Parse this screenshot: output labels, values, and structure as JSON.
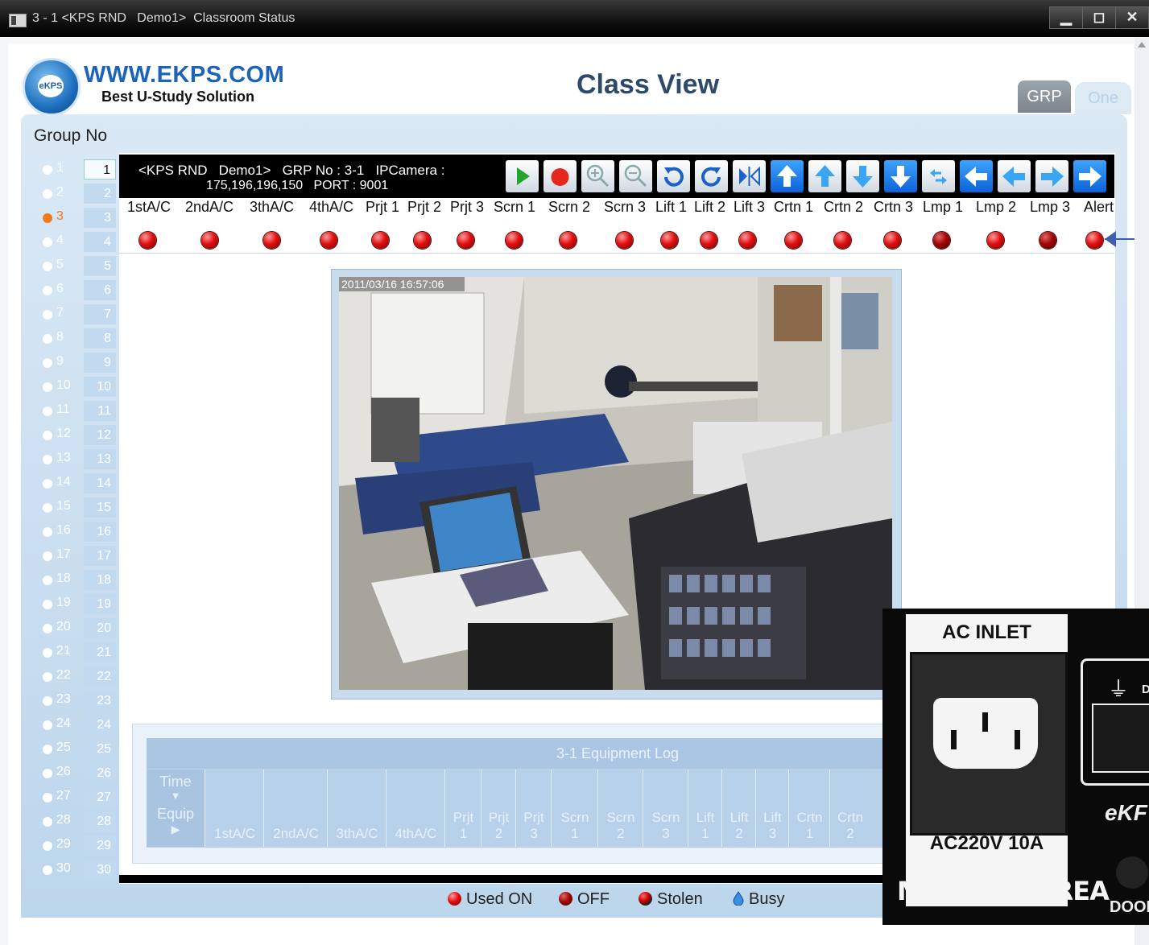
{
  "window": {
    "title": "3 - 1 <KPS RND   Demo1>  Classroom Status",
    "controls": [
      "▁",
      "◻",
      "✕"
    ]
  },
  "header": {
    "logo_badge": "eKPS",
    "logo_url": "WWW.EKPS.COM",
    "logo_tagline": "Best U-Study Solution",
    "page_title": "Class View",
    "tabs": [
      "GRP",
      "One"
    ]
  },
  "group": {
    "label": "Group No",
    "selected": 3,
    "items": [
      "1",
      "2",
      "3",
      "4",
      "5",
      "6",
      "7",
      "8",
      "9",
      "10",
      "11",
      "12",
      "13",
      "14",
      "15",
      "16",
      "17",
      "18",
      "19",
      "20",
      "21",
      "22",
      "23",
      "24",
      "25",
      "26",
      "27",
      "28",
      "29",
      "30"
    ]
  },
  "info": {
    "line1": "<KPS RND   Demo1>   GRP No : 3-1   IPCamera :",
    "line2": "175,196,196,150   PORT : 9001"
  },
  "toolbar_icons": [
    "play-icon",
    "record-icon",
    "zoom-in-icon",
    "zoom-out-icon",
    "rotate-left-icon",
    "rotate-right-icon",
    "flip-icon",
    "up-arrow-icon",
    "up-light-arrow-icon",
    "down-light-arrow-icon",
    "down-arrow-icon",
    "swap-icon",
    "left-arrow-icon",
    "left-light-arrow-icon",
    "right-light-arrow-icon",
    "right-arrow-icon"
  ],
  "equipment": {
    "labels": [
      "1stA/C",
      "2ndA/C",
      "3thA/C",
      "4thA/C",
      "Prjt 1",
      "Prjt 2",
      "Prjt 3",
      "Scrn 1",
      "Scrn 2",
      "Scrn 3",
      "Lift 1",
      "Lift 2",
      "Lift 3",
      "Crtn 1",
      "Crtn 2",
      "Crtn 3",
      "Lmp 1",
      "Lmp 2",
      "Lmp 3",
      "Alert"
    ],
    "status": [
      "on",
      "on",
      "on",
      "on",
      "on",
      "on",
      "on",
      "on",
      "on",
      "on",
      "on",
      "on",
      "on",
      "on",
      "on",
      "on",
      "off",
      "on",
      "off",
      "on"
    ]
  },
  "camera": {
    "timestamp": "2011/03/16 16:57:06"
  },
  "log": {
    "title": "3-1 Equipment Log",
    "time_label": "Time",
    "equip_label": "Equip",
    "down_glyph": "▼",
    "right_glyph": "▶",
    "columns": [
      "1stA/C",
      "2ndA/C",
      "3thA/C",
      "4thA/C",
      "Prjt\n1",
      "Prjt\n2",
      "Prjt\n3",
      "Scrn\n1",
      "Scrn\n2",
      "Scrn\n3",
      "Lift\n1",
      "Lift\n2",
      "Lift\n3",
      "Crtn\n1",
      "Crtn\n2"
    ]
  },
  "legend": {
    "used_on": "Used ON",
    "off": "OFF",
    "stolen": "Stolen",
    "busy": "Busy"
  },
  "overlay": {
    "title": "AC INLET",
    "rating": "AC220V 10A",
    "made_in": "Made in KOREA",
    "ground_glyph": "⏚",
    "d_label": "D",
    "brand": "eKF",
    "door": "DOOR"
  },
  "colors": {
    "accent_blue": "#1d64b8",
    "led_on": "#e01010",
    "led_off": "#a20606",
    "selected_group": "#f07a1c"
  }
}
